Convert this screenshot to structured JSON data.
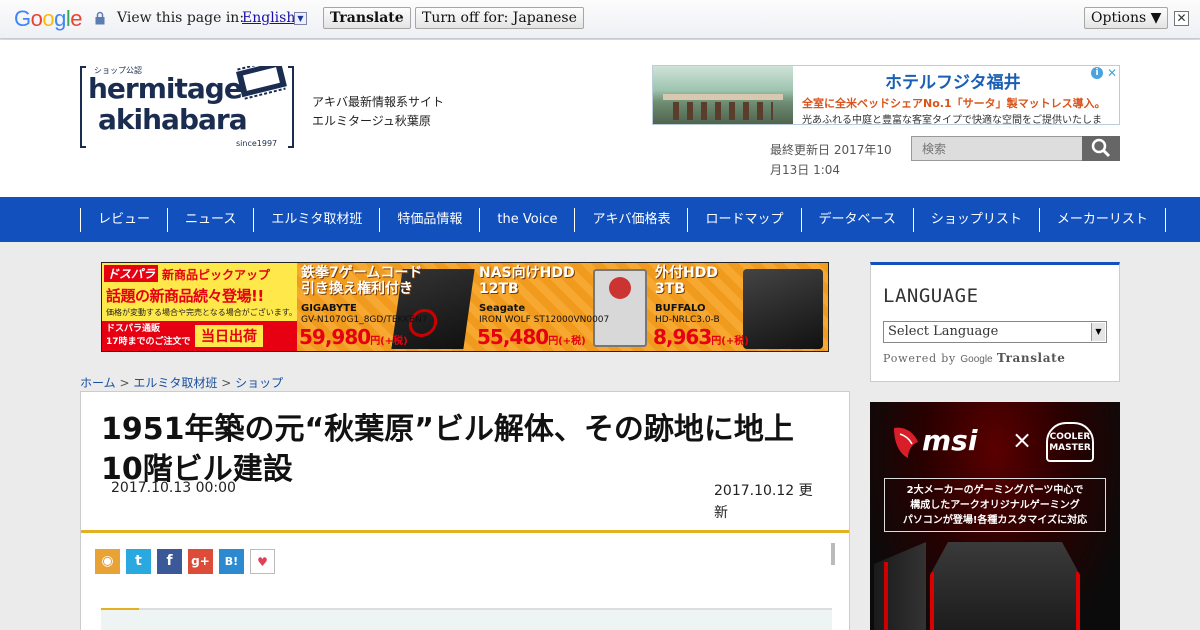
{
  "translate_bar": {
    "logo": "Google",
    "prompt": "View this page in:",
    "language": "English",
    "translate_label": "Translate",
    "turnoff_label": "Turn off for: Japanese",
    "options_label": "Options ▼",
    "close_label": "✕"
  },
  "header": {
    "logo_top": "ショップ公認",
    "logo_line1": "hermitage",
    "logo_line2": "akihabara",
    "logo_since": "since1997",
    "tagline_1": "アキバ最新情報系サイト",
    "tagline_2": "エルミタージュ秋葉原",
    "date_text": "最終更新日 2017年10月13日 1:04",
    "search_placeholder": "検索"
  },
  "hotel_ad": {
    "title": "ホテルフジタ福井",
    "line1": "全室に全米ベッドシェアNo.1「サータ」製マットレス導入。",
    "line2": "光あふれる中庭と豊富な客室タイプで快適な空間をご提供いたします。",
    "badge": "i",
    "close": "✕"
  },
  "nav": {
    "items": [
      "レビュー",
      "ニュース",
      "エルミタ取材班",
      "特価品情報",
      "the Voice",
      "アキバ価格表",
      "ロードマップ",
      "データベース",
      "ショップリスト",
      "メーカーリスト"
    ]
  },
  "banner": {
    "tag": "ドスパラ",
    "new_label": "新商品ピックアップ",
    "headline": "話題の新商品続々登場!!",
    "note": "価格が変動する場合や完売となる場合がございます。",
    "store_line1": "ドスパラ通販",
    "store_line2": "17時までのご注文で",
    "ship": "当日出荷",
    "items": [
      {
        "headline_1": "鉄拳7ゲームコード",
        "headline_2": "引き換え権利付き",
        "brand": "GIGABYTE",
        "model": "GV-N1070G1_8GD/TEKKEN7",
        "price": "59,980",
        "tax": "円(+税)"
      },
      {
        "headline_1": "NAS向けHDD",
        "headline_2": "12TB",
        "brand": "Seagate",
        "model": "IRON WOLF ST12000VN0007",
        "price": "55,480",
        "tax": "円(+税)"
      },
      {
        "headline_1": "外付HDD",
        "headline_2": "3TB",
        "brand": "BUFFALO",
        "model": "HD-NRLC3.0-B",
        "price": "8,963",
        "tax": "円(+税)"
      }
    ]
  },
  "breadcrumb": {
    "items": [
      "ホーム",
      "エルミタ取材班",
      "ショップ"
    ],
    "separator": ">"
  },
  "article": {
    "title": "1951年築の元“秋葉原”ビル解体、その跡地に地上10階ビル建設",
    "date": "2017.10.13 00:00",
    "updated": "2017.10.12 更新"
  },
  "share": {
    "rss": "◉",
    "twitter": "t",
    "facebook": "f",
    "gplus": "g+",
    "hatena": "B!",
    "pocket": "♥"
  },
  "sidebar": {
    "language_title": "LANGUAGE",
    "select_label": "Select Language",
    "powered_by": "Powered by",
    "google": "Google",
    "translate": "Translate"
  },
  "msi_ad": {
    "brand": "msi",
    "x": "×",
    "cm": "COOLER MASTER",
    "copy_1": "2大メーカーのゲーミングパーツ中心で",
    "copy_2": "構成したアークオリジナルゲーミング",
    "copy_3": "パソコンが登場!各種カスタマイズに対応"
  },
  "colors": {
    "nav_blue": "#1250be",
    "accent_gold": "#e2b020",
    "banner_red": "#e60012"
  }
}
